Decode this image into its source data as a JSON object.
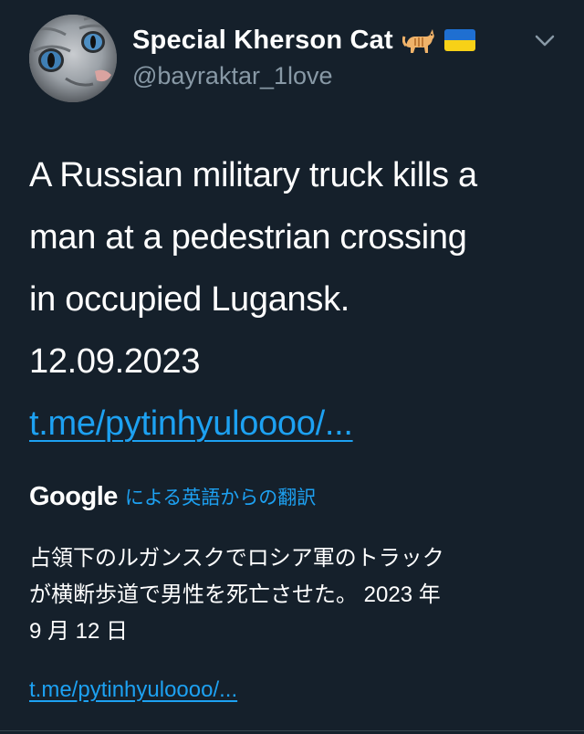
{
  "author": {
    "display_name": "Special Kherson Cat",
    "handle": "@bayraktar_1love",
    "name_emojis": [
      "cat-emoji",
      "ukraine-flag-emoji"
    ]
  },
  "tweet": {
    "lines": [
      "A Russian military truck kills a",
      "man at a pedestrian crossing",
      "in occupied Lugansk.",
      "12.09.2023"
    ],
    "link": "t.me/pytinhyuloooo/..."
  },
  "translation": {
    "provider": "Google",
    "label": "による英語からの翻訳",
    "lines": [
      "占領下のルガンスクでロシア軍のトラック",
      "が横断歩道で男性を死亡させた。 2023 年",
      "9 月 12 日"
    ],
    "link": "t.me/pytinhyuloooo/..."
  },
  "colors": {
    "background": "#15202b",
    "text_primary": "#ffffff",
    "text_secondary": "#8899a6",
    "accent": "#1da1f2"
  }
}
